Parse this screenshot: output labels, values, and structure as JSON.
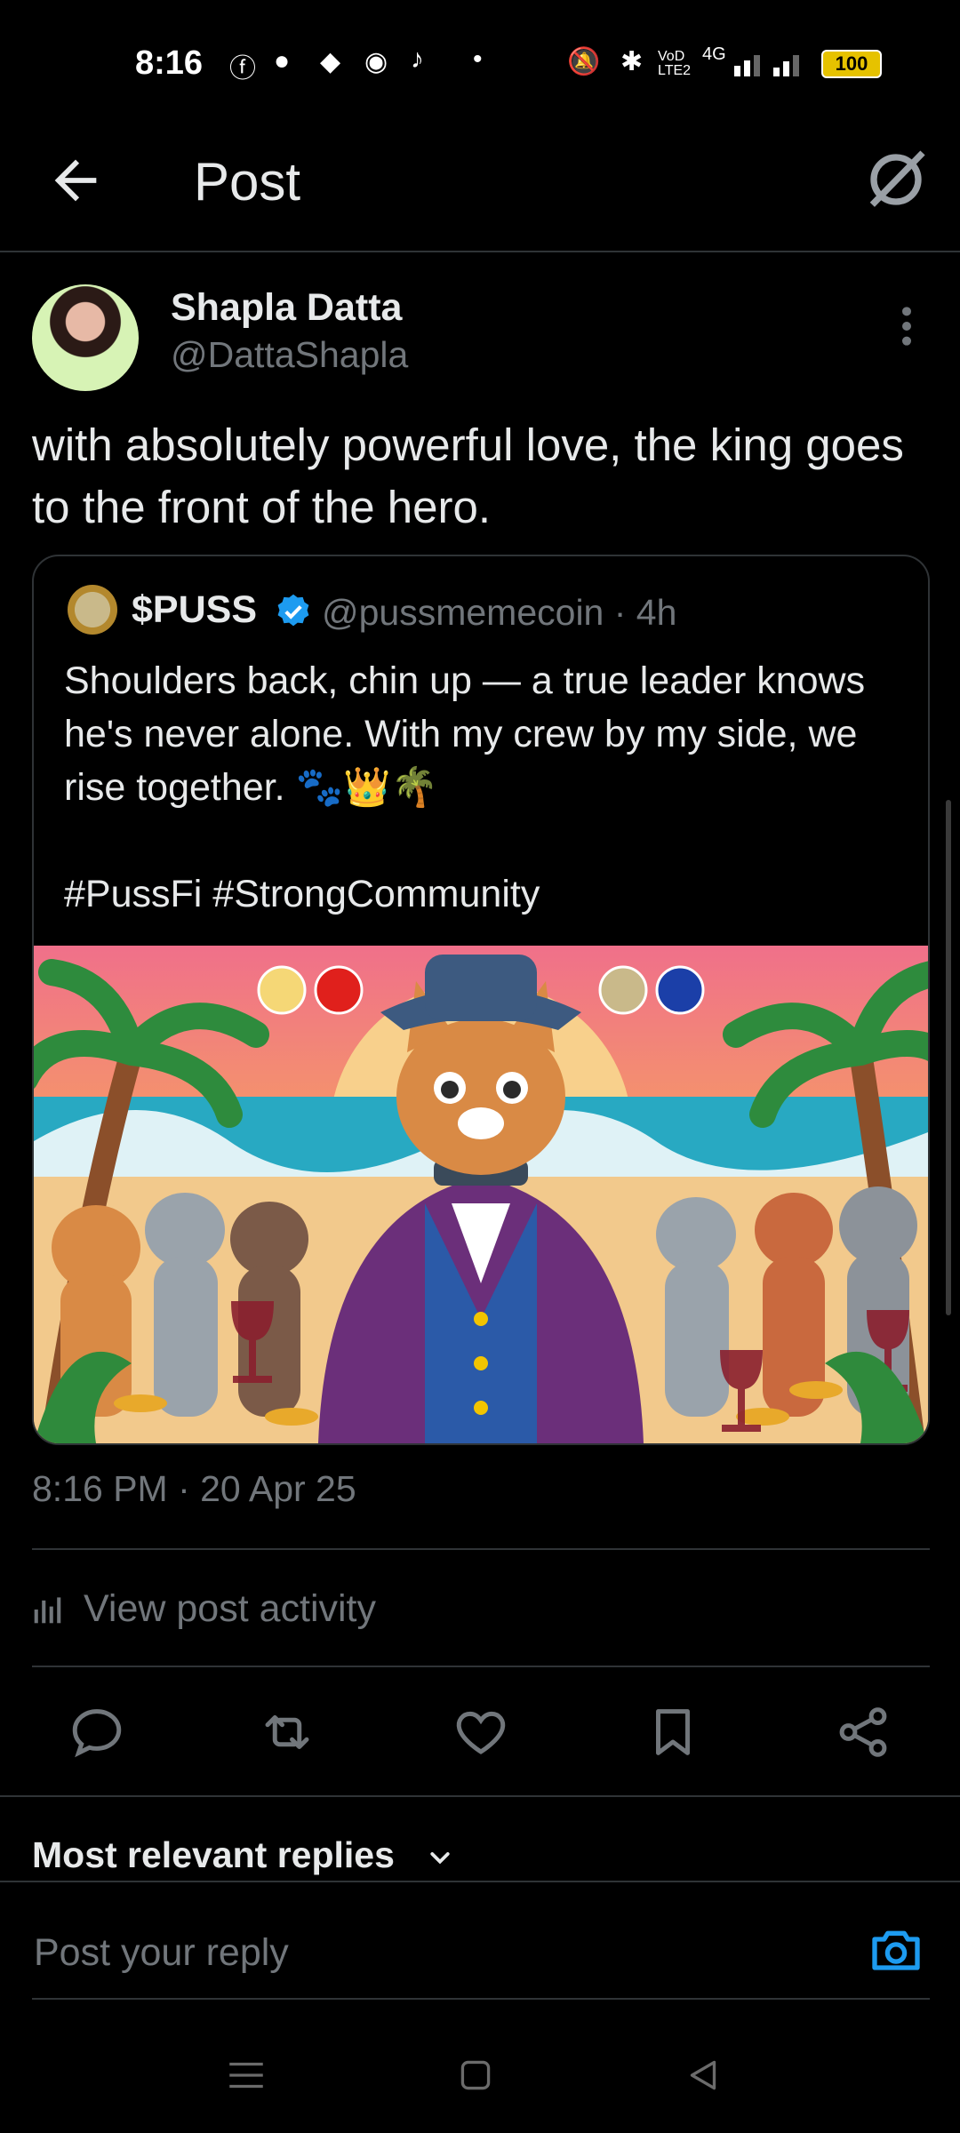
{
  "status_bar": {
    "time": "8:16",
    "battery": "100",
    "network": "4G",
    "volte": "VoD LTE2"
  },
  "header": {
    "title": "Post"
  },
  "post": {
    "author_name": "Shapla Datta",
    "author_handle": "@DattaShapla",
    "text": "with absolutely powerful love, the king goes to the front of the hero.",
    "timestamp": "8:16 PM · 20 Apr 25"
  },
  "quoted_post": {
    "author_name": "$PUSS",
    "author_handle_time": "@pussmemecoin · 4h",
    "text": "Shoulders back, chin up — a true leader knows he's never alone. With my crew by my side, we rise together. 🐾👑🌴\n\n#PussFi #StrongCommunity"
  },
  "activity": {
    "label": "View post activity"
  },
  "replies": {
    "heading": "Most relevant replies"
  },
  "composer": {
    "placeholder": "Post your reply"
  },
  "colors": {
    "background": "#000000",
    "text_primary": "#e7e9ea",
    "text_secondary": "#71767b",
    "divider": "#2f3336",
    "accent": "#1d9bf0"
  },
  "icons": {
    "back": "arrow-left-icon",
    "grok": "slash-circle-icon",
    "more": "vertical-dots-icon",
    "verified": "verified-badge-icon",
    "activity": "bar-chart-icon",
    "reply": "speech-bubble-icon",
    "repost": "repost-arrows-icon",
    "like": "heart-icon",
    "bookmark": "bookmark-icon",
    "share": "share-icon",
    "camera": "camera-icon"
  }
}
